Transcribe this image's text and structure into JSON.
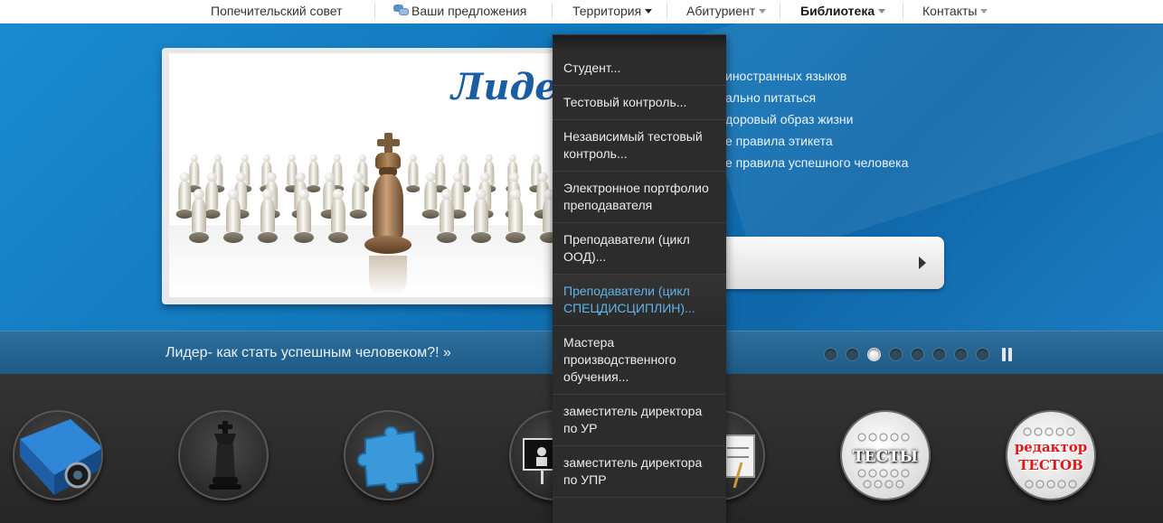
{
  "nav": {
    "items": [
      {
        "label": "Попечительский совет"
      },
      {
        "label": "Ваши предложения"
      },
      {
        "label": "Территория"
      },
      {
        "label": "Абитуриент"
      },
      {
        "label": "Библиотека"
      },
      {
        "label": "Контакты"
      }
    ]
  },
  "hero": {
    "slide_title": "Лиде",
    "info_items": [
      "иностранных языков",
      "ально питаться",
      "доровый образ жизни",
      "е правила этикета",
      "е правила успешного человека"
    ]
  },
  "caption": {
    "text": "Лидер- как стать успешным человеком?! »",
    "dots_total": 8,
    "active_dot": 3
  },
  "dropdown": {
    "items": [
      {
        "label": "Студент..."
      },
      {
        "label": "Тестовый контроль..."
      },
      {
        "label": "Независимый тестовый контроль..."
      },
      {
        "label": "Электронное портфолио преподавателя"
      },
      {
        "label": "Преподаватели (цикл ООД)..."
      },
      {
        "label": "Преподаватели (цикл СПЕЦДИСЦИПЛИН)..."
      },
      {
        "label": "Мастера производственного обучения..."
      },
      {
        "label": "заместитель директора по УР"
      },
      {
        "label": "заместитель директора по УПР"
      }
    ]
  },
  "bottom_icons": {
    "tests_label": "ТЕСТЫ",
    "editor_label_1": "редактор",
    "editor_label_2": "ТЕСТОВ"
  },
  "colors": {
    "hero_blue": "#1176ba",
    "dropdown_bg": "#2c2c2c",
    "active_item": "#5fb3e8"
  }
}
